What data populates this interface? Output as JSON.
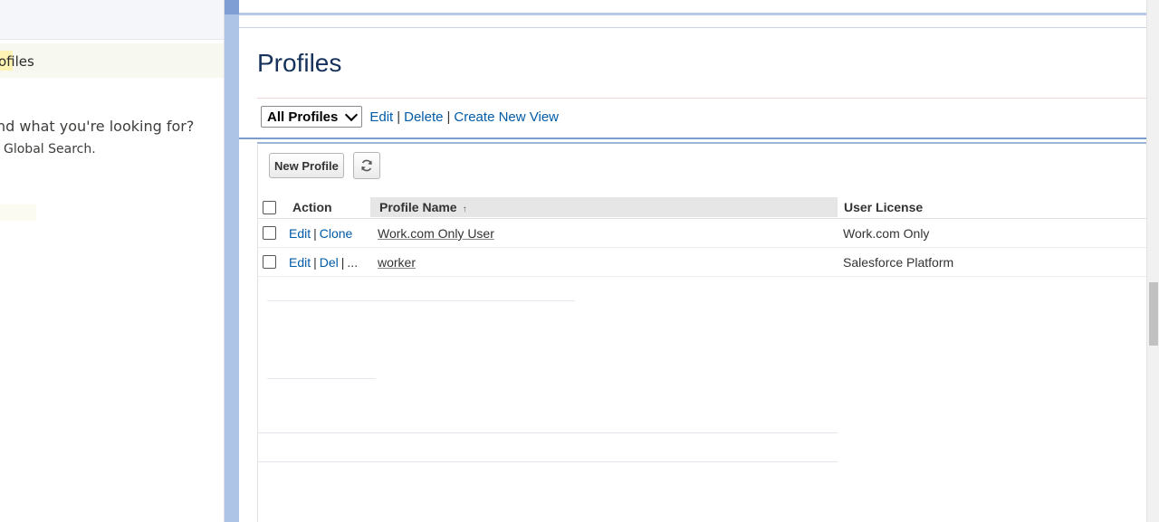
{
  "left_panel": {
    "breadcrumb_label": "ofiles",
    "help_line1": "nd what you're looking for?",
    "help_line2": "Global Search."
  },
  "page": {
    "title": "Profiles"
  },
  "view_bar": {
    "selected_view": "All Profiles",
    "edit_label": "Edit",
    "delete_label": "Delete",
    "create_label": "Create New View",
    "separator": "|"
  },
  "toolbar": {
    "new_profile_label": "New Profile",
    "refresh_icon": "refresh-icon"
  },
  "table": {
    "columns": {
      "action": "Action",
      "profile_name": "Profile Name",
      "sort_indicator": "↑",
      "user_license": "User License"
    },
    "rows": [
      {
        "action_1": "Edit",
        "action_2": "Clone",
        "profile_name": "Work.com Only User",
        "user_license": "Work.com Only"
      },
      {
        "action_1": "Edit",
        "action_2": "Del",
        "action_more": "...",
        "profile_name": "worker",
        "user_license": "Salesforce Platform"
      }
    ]
  },
  "colors": {
    "link": "#015ba7",
    "title": "#16325c",
    "divider": "#aec4e6"
  }
}
